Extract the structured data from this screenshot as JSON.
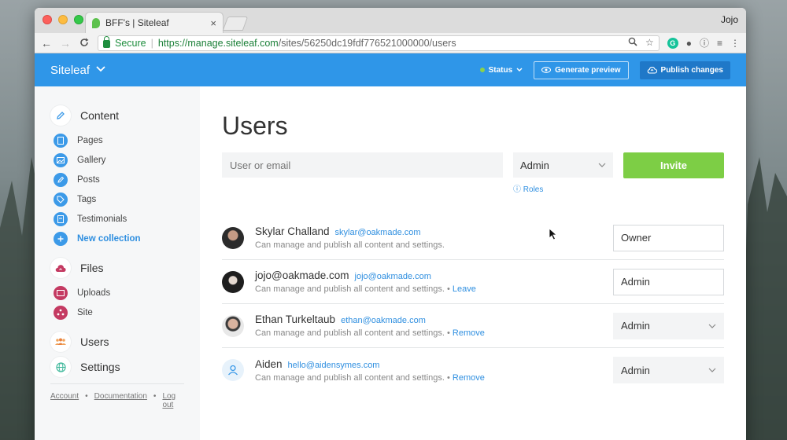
{
  "browser": {
    "tab_title": "BFF's | Siteleaf",
    "tab_close": "×",
    "profile_name": "Jojo",
    "nav_back": "←",
    "nav_forward": "→",
    "nav_reload": "C",
    "secure_label": "Secure",
    "url_host": "https://manage.siteleaf.com",
    "url_path": "/sites/56250dc19fdf776521000000/users"
  },
  "app_header": {
    "brand": "Siteleaf",
    "status_label": "Status",
    "generate_preview": "Generate preview",
    "publish_changes": "Publish changes"
  },
  "sidebar": {
    "content_label": "Content",
    "items": [
      {
        "label": "Pages"
      },
      {
        "label": "Gallery"
      },
      {
        "label": "Posts"
      },
      {
        "label": "Tags"
      },
      {
        "label": "Testimonials"
      },
      {
        "label": "New collection"
      }
    ],
    "files_label": "Files",
    "file_items": [
      {
        "label": "Uploads"
      },
      {
        "label": "Site"
      }
    ],
    "users_label": "Users",
    "settings_label": "Settings",
    "footer": {
      "account": "Account",
      "documentation": "Documentation",
      "logout": "Log out",
      "dot": "•"
    }
  },
  "main": {
    "title": "Users",
    "invite": {
      "placeholder": "User or email",
      "role_selected": "Admin",
      "roles_link": "Roles",
      "button": "Invite"
    },
    "users": [
      {
        "name": "Skylar Challand",
        "email": "skylar@oakmade.com",
        "desc": "Can manage and publish all content and settings.",
        "action": "",
        "role": "Owner"
      },
      {
        "name": "jojo@oakmade.com",
        "email": "jojo@oakmade.com",
        "desc": "Can manage and publish all content and settings.",
        "action": "Leave",
        "role": "Admin"
      },
      {
        "name": "Ethan Turkeltaub",
        "email": "ethan@oakmade.com",
        "desc": "Can manage and publish all content and settings.",
        "action": "Remove",
        "role": "Admin"
      },
      {
        "name": "Aiden",
        "email": "hello@aidensymes.com",
        "desc": "Can manage and publish all content and settings.",
        "action": "Remove",
        "role": "Admin"
      }
    ],
    "action_sep": " • "
  }
}
